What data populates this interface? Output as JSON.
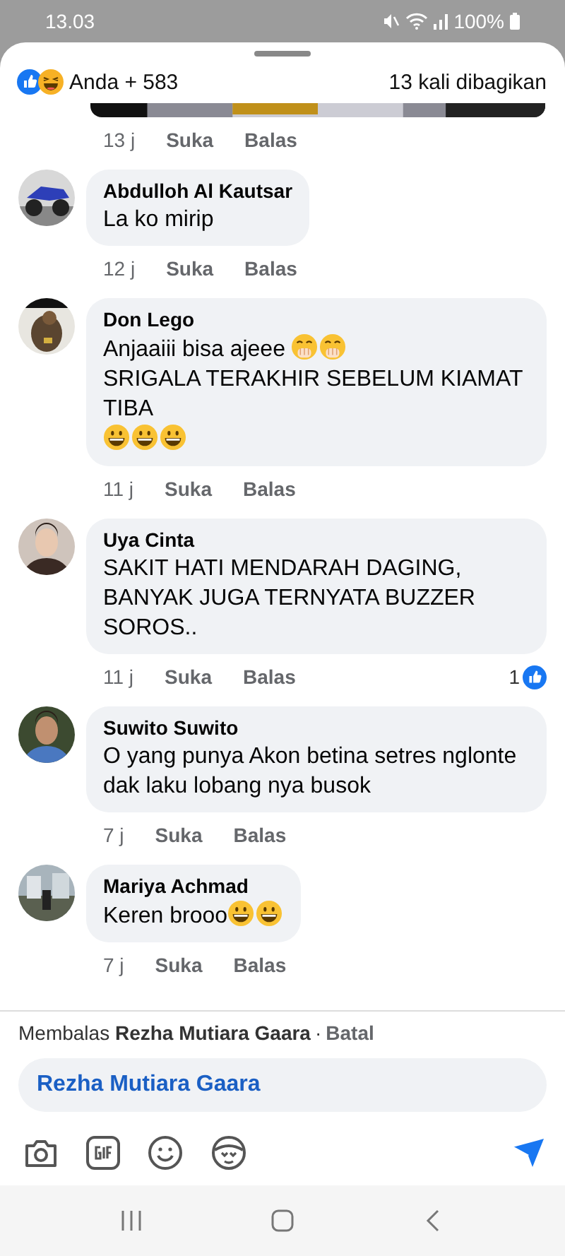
{
  "status_bar": {
    "time": "13.03",
    "battery": "100%"
  },
  "reactions": {
    "summary": "Anda + 583",
    "shares": "13 kali dibagikan"
  },
  "top_meta": {
    "time": "13 j",
    "like": "Suka",
    "reply": "Balas"
  },
  "comments": [
    {
      "author": "Abdulloh Al Kautsar",
      "lines": [
        [
          {
            "kind": "text",
            "text": "La ko mirip"
          }
        ]
      ],
      "time": "12 j",
      "like": "Suka",
      "reply": "Balas"
    },
    {
      "author": "Don Lego",
      "lines": [
        [
          {
            "kind": "text",
            "text": "Anjaaiii bisa ajeee "
          },
          {
            "kind": "giggle"
          },
          {
            "kind": "giggle"
          }
        ],
        [
          {
            "kind": "text",
            "text": "SRIGALA TERAKHIR SEBELUM KIAMAT TIBA"
          }
        ],
        [
          {
            "kind": "grin"
          },
          {
            "kind": "grin"
          },
          {
            "kind": "grin"
          }
        ]
      ],
      "time": "11 j",
      "like": "Suka",
      "reply": "Balas"
    },
    {
      "author": "Uya Cinta",
      "lines": [
        [
          {
            "kind": "text",
            "text": "SAKIT HATI MENDARAH DAGING, BANYAK JUGA TERNYATA BUZZER SOROS.."
          }
        ]
      ],
      "time": "11 j",
      "like": "Suka",
      "reply": "Balas",
      "like_count": "1"
    },
    {
      "author": "Suwito Suwito",
      "lines": [
        [
          {
            "kind": "text",
            "text": "O yang punya Akon betina setres nglonte dak laku lobang nya busok"
          }
        ]
      ],
      "time": "7 j",
      "like": "Suka",
      "reply": "Balas"
    },
    {
      "author": "Mariya Achmad",
      "lines": [
        [
          {
            "kind": "text",
            "text": "Keren brooo"
          },
          {
            "kind": "grin"
          },
          {
            "kind": "grin"
          }
        ]
      ],
      "time": "7 j",
      "like": "Suka",
      "reply": "Balas"
    }
  ],
  "reply_bar": {
    "text": "Membalas **Rezha Mutiara Gaara**",
    "separator": "·",
    "cancel": "Batal"
  },
  "composer": {
    "value": "Rezha Mutiara Gaara"
  }
}
